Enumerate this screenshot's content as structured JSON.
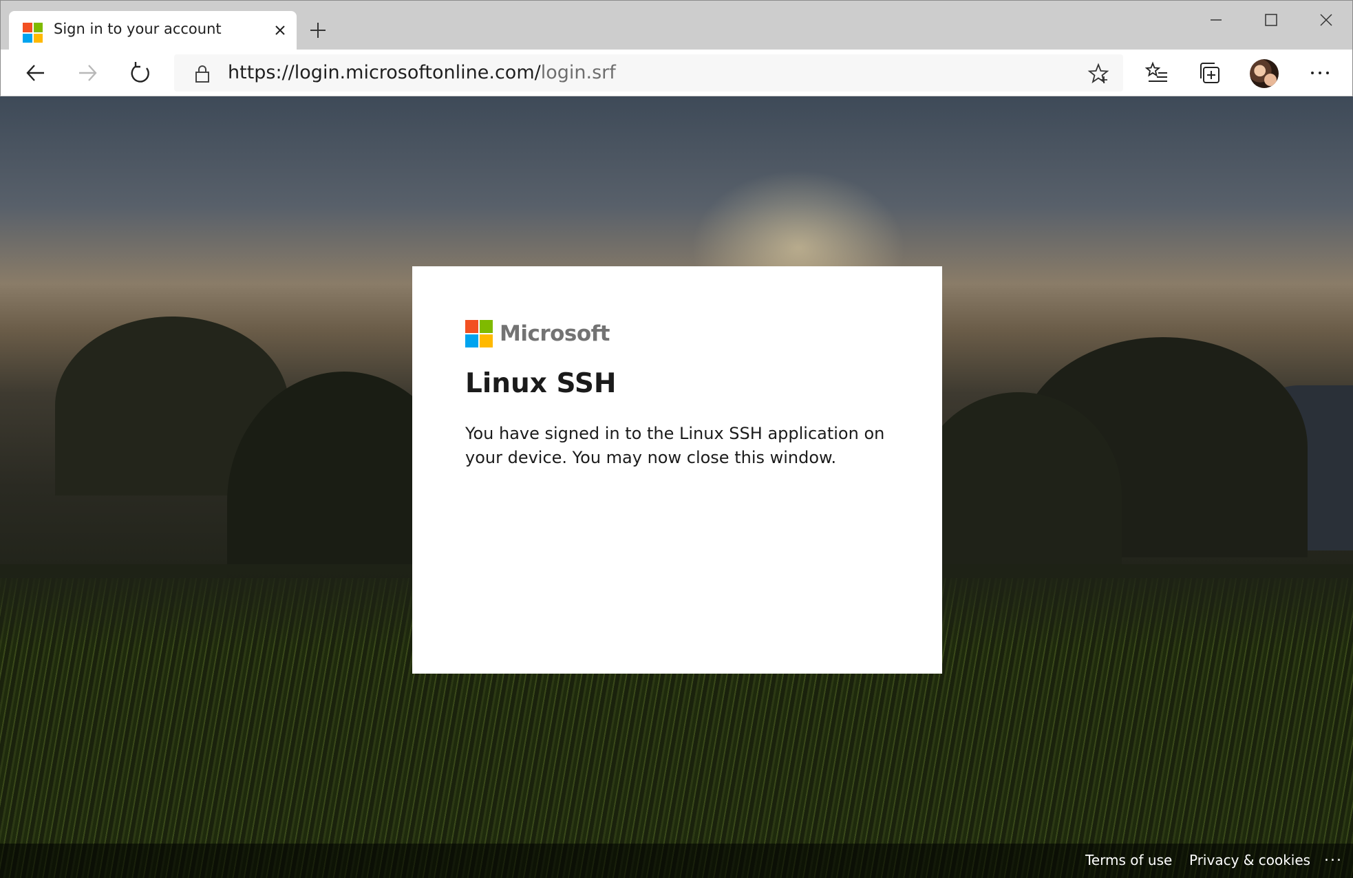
{
  "browser": {
    "tab_title": "Sign in to your account",
    "url_host": "https://login.microsoftonline.com/",
    "url_path": "login.srf",
    "icons": {
      "tab_close": "close-icon",
      "new_tab": "plus-icon",
      "minimize": "minimize-icon",
      "maximize": "maximize-icon",
      "close_window": "close-icon",
      "back": "arrow-left-icon",
      "forward": "arrow-right-icon",
      "reload": "refresh-icon",
      "lock": "lock-icon",
      "favorite": "star-icon",
      "favorites": "favorites-list-icon",
      "collections": "collections-icon",
      "profile": "avatar",
      "more": "more-icon"
    }
  },
  "card": {
    "brand": "Microsoft",
    "title": "Linux SSH",
    "message": "You have signed in to the Linux SSH application on your device. You may now close this window."
  },
  "footer": {
    "terms": "Terms of use",
    "privacy": "Privacy & cookies",
    "more": "..."
  },
  "colors": {
    "ms_red": "#f25022",
    "ms_green": "#7fba00",
    "ms_blue": "#00a4ef",
    "ms_yellow": "#ffb900"
  }
}
